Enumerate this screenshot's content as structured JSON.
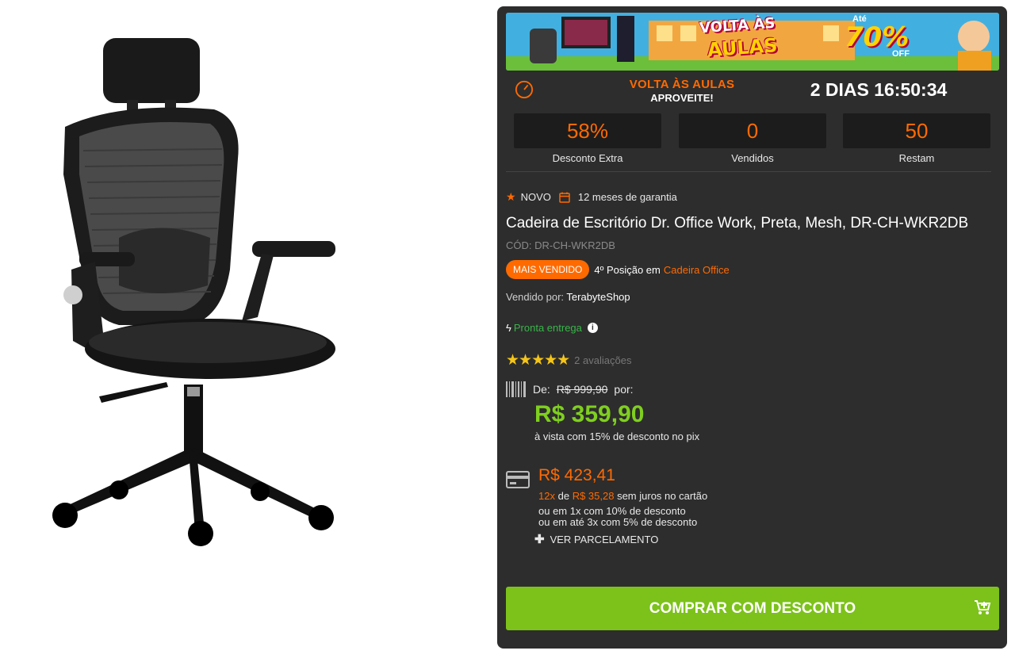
{
  "banner": {
    "line1": "VOLTA ÀS",
    "line2": "AULAS",
    "upto": "Até",
    "percent": "70%",
    "off": "OFF"
  },
  "promo": {
    "title": "VOLTA ÀS AULAS",
    "subtitle": "APROVEITE!",
    "countdown": "2 DIAS 16:50:34"
  },
  "stats": [
    {
      "value": "58%",
      "label": "Desconto Extra"
    },
    {
      "value": "0",
      "label": "Vendidos"
    },
    {
      "value": "50",
      "label": "Restam"
    }
  ],
  "tags": {
    "condition": "NOVO",
    "warranty": "12 meses de garantia"
  },
  "product": {
    "title": "Cadeira de Escritório Dr. Office Work, Preta, Mesh, DR-CH-WKR2DB",
    "code": "CÓD: DR-CH-WKR2DB",
    "badge": "MAIS VENDIDO",
    "rank_text": "4º Posição em",
    "rank_category": "Cadeira Office",
    "seller_label": "Vendido por:",
    "seller_name": "TerabyteShop",
    "availability": "Pronta entrega",
    "rating": 5,
    "reviews": "2 avaliações"
  },
  "pricing": {
    "de_label": "De:",
    "old_price": "R$ 999,90",
    "por_label": "por:",
    "pix_price": "R$ 359,90",
    "pix_note": "à vista com 15% de desconto no pix",
    "card_price": "R$ 423,41",
    "inst_count": "12x",
    "inst_de": "de",
    "inst_value": "R$ 35,28",
    "inst_suffix": "sem juros no cartão",
    "disc_1x": "ou em 1x com 10% de desconto",
    "disc_3x": "ou em até 3x com 5% de desconto",
    "installments_link": "VER PARCELAMENTO"
  },
  "buy_button": "COMPRAR COM DESCONTO",
  "colors": {
    "accent": "#ff6a00",
    "green": "#7cc21a",
    "panel": "#2d2d2d"
  }
}
